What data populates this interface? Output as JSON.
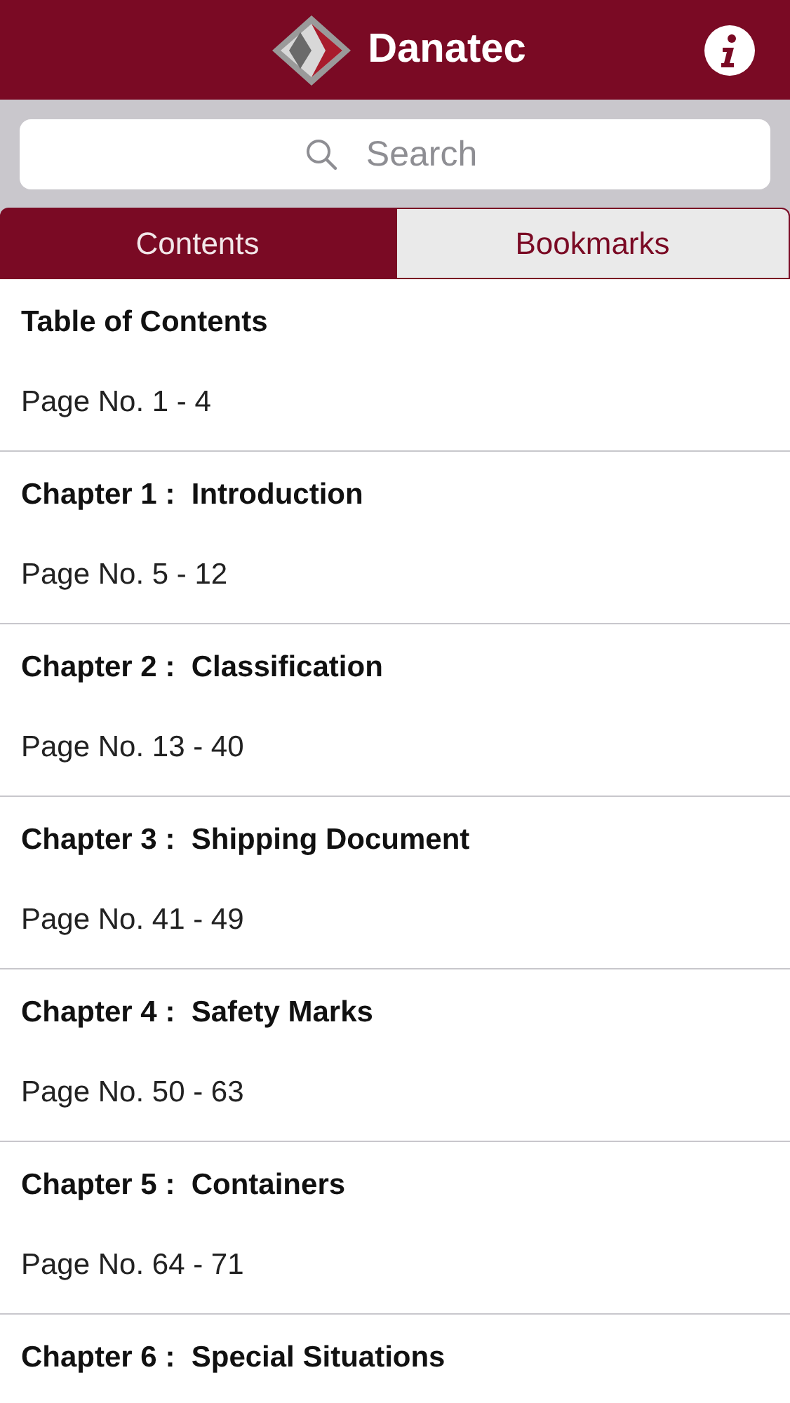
{
  "header": {
    "title": "Danatec"
  },
  "search": {
    "placeholder": "Search"
  },
  "tabs": [
    {
      "label": "Contents",
      "selected": true
    },
    {
      "label": "Bookmarks",
      "selected": false
    }
  ],
  "contents": [
    {
      "title": "Table of Contents",
      "pages": "Page No. 1 - 4"
    },
    {
      "title": "Chapter 1 :  Introduction",
      "pages": "Page No. 5 - 12"
    },
    {
      "title": "Chapter 2 :  Classification",
      "pages": "Page No. 13 - 40"
    },
    {
      "title": "Chapter 3 :  Shipping Document",
      "pages": "Page No. 41 - 49"
    },
    {
      "title": "Chapter 4 :  Safety Marks",
      "pages": "Page No. 50 - 63"
    },
    {
      "title": "Chapter 5 :  Containers",
      "pages": "Page No. 64 - 71"
    },
    {
      "title": "Chapter 6 :  Special Situations"
    }
  ]
}
